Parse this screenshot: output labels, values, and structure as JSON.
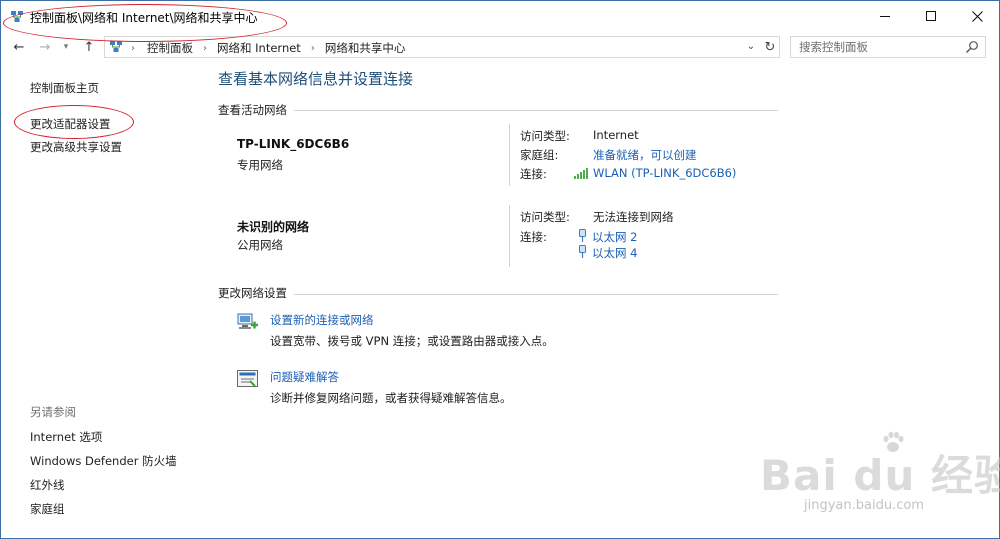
{
  "window": {
    "title": "控制面板\\网络和 Internet\\网络和共享中心"
  },
  "address": {
    "crumbs": [
      "控制面板",
      "网络和 Internet",
      "网络和共享中心"
    ],
    "search_placeholder": "搜索控制面板"
  },
  "sidebar": {
    "links": [
      "控制面板主页",
      "更改适配器设置",
      "更改高级共享设置"
    ],
    "see_also_title": "另请参阅",
    "see_also": [
      "Internet 选项",
      "Windows Defender 防火墙",
      "红外线",
      "家庭组"
    ]
  },
  "main": {
    "title": "查看基本网络信息并设置连接",
    "active_networks_heading": "查看活动网络",
    "networks": [
      {
        "name": "TP-LINK_6DC6B6",
        "type": "专用网络",
        "access_type_label": "访问类型:",
        "access_type": "Internet",
        "homegroup_label": "家庭组:",
        "homegroup": "准备就绪，可以创建",
        "connections_label": "连接:",
        "connections": [
          "WLAN (TP-LINK_6DC6B6)"
        ]
      },
      {
        "name": "未识别的网络",
        "type": "公用网络",
        "access_type_label": "访问类型:",
        "access_type": "无法连接到网络",
        "connections_label": "连接:",
        "connections": [
          "以太网 2",
          "以太网 4"
        ]
      }
    ],
    "change_settings_heading": "更改网络设置",
    "tasks": [
      {
        "title": "设置新的连接或网络",
        "description": "设置宽带、拨号或 VPN 连接；或设置路由器或接入点。",
        "icon": "network-setup-icon"
      },
      {
        "title": "问题疑难解答",
        "description": "诊断并修复网络问题，或者获得疑难解答信息。",
        "icon": "troubleshoot-icon"
      }
    ]
  },
  "watermark": {
    "logo": "Bai du 经验",
    "url": "jingyan.baidu.com"
  },
  "colors": {
    "link": "#1a5fb4",
    "title": "#1e4e79",
    "annotation": "#d4212b"
  }
}
